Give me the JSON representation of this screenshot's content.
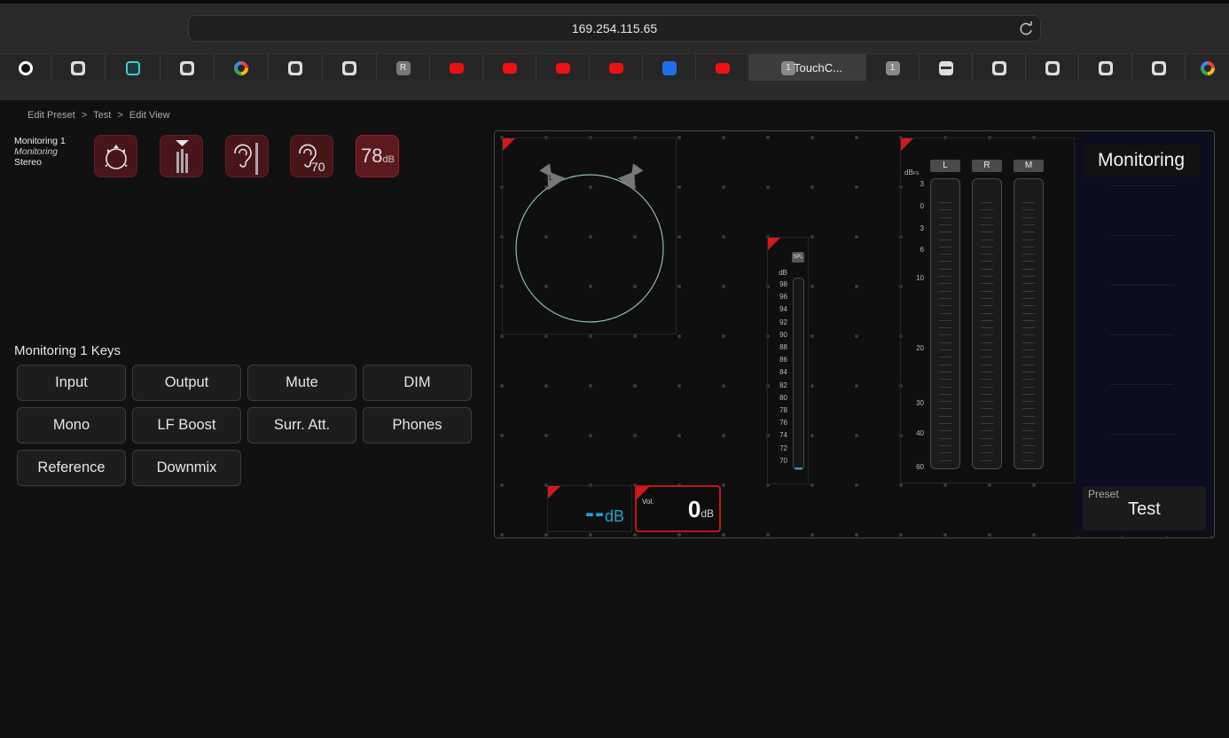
{
  "browser": {
    "url": "169.254.115.65",
    "active_tab_title": "TouchC...",
    "active_tab_badge": "1",
    "tab_badge_2": "1",
    "tab_badge_r": "R"
  },
  "breadcrumb": [
    "Edit Preset",
    ">",
    "Test",
    ">",
    "Edit View"
  ],
  "monitor": {
    "name": "Monitoring 1",
    "type": "Monitoring",
    "format": "Stereo",
    "spl_value": "78",
    "spl_unit": "dB",
    "phones_level": "70"
  },
  "keys": {
    "title": "Monitoring 1 Keys",
    "items": [
      "Input",
      "Output",
      "Mute",
      "DIM",
      "Mono",
      "LF Boost",
      "Surr. Att.",
      "Phones",
      "Reference",
      "Downmix"
    ]
  },
  "speaker": {
    "left": "L",
    "right": "R"
  },
  "spl_meter": {
    "badge": "SPL",
    "unit": "dB",
    "scale": [
      "98",
      "96",
      "94",
      "92",
      "90",
      "88",
      "86",
      "84",
      "82",
      "80",
      "78",
      "76",
      "74",
      "72",
      "70"
    ]
  },
  "level_meter": {
    "unit": "dB",
    "unit_sub": "FS",
    "channels": [
      "L",
      "R",
      "M"
    ],
    "scale": [
      "3",
      "0",
      "3",
      "6",
      "10",
      "20",
      "30",
      "40",
      "60"
    ]
  },
  "level_display": {
    "value": "--",
    "unit": "dB"
  },
  "volume": {
    "label": "Vol.",
    "value": "0",
    "unit": "dB"
  },
  "monitoring_panel": {
    "title": "Monitoring",
    "preset_label": "Preset",
    "preset_value": "Test"
  },
  "colors": {
    "accent_red": "#d21a1a",
    "meter_blue": "#1fa3d6",
    "button_maroon": "#4a1518"
  }
}
